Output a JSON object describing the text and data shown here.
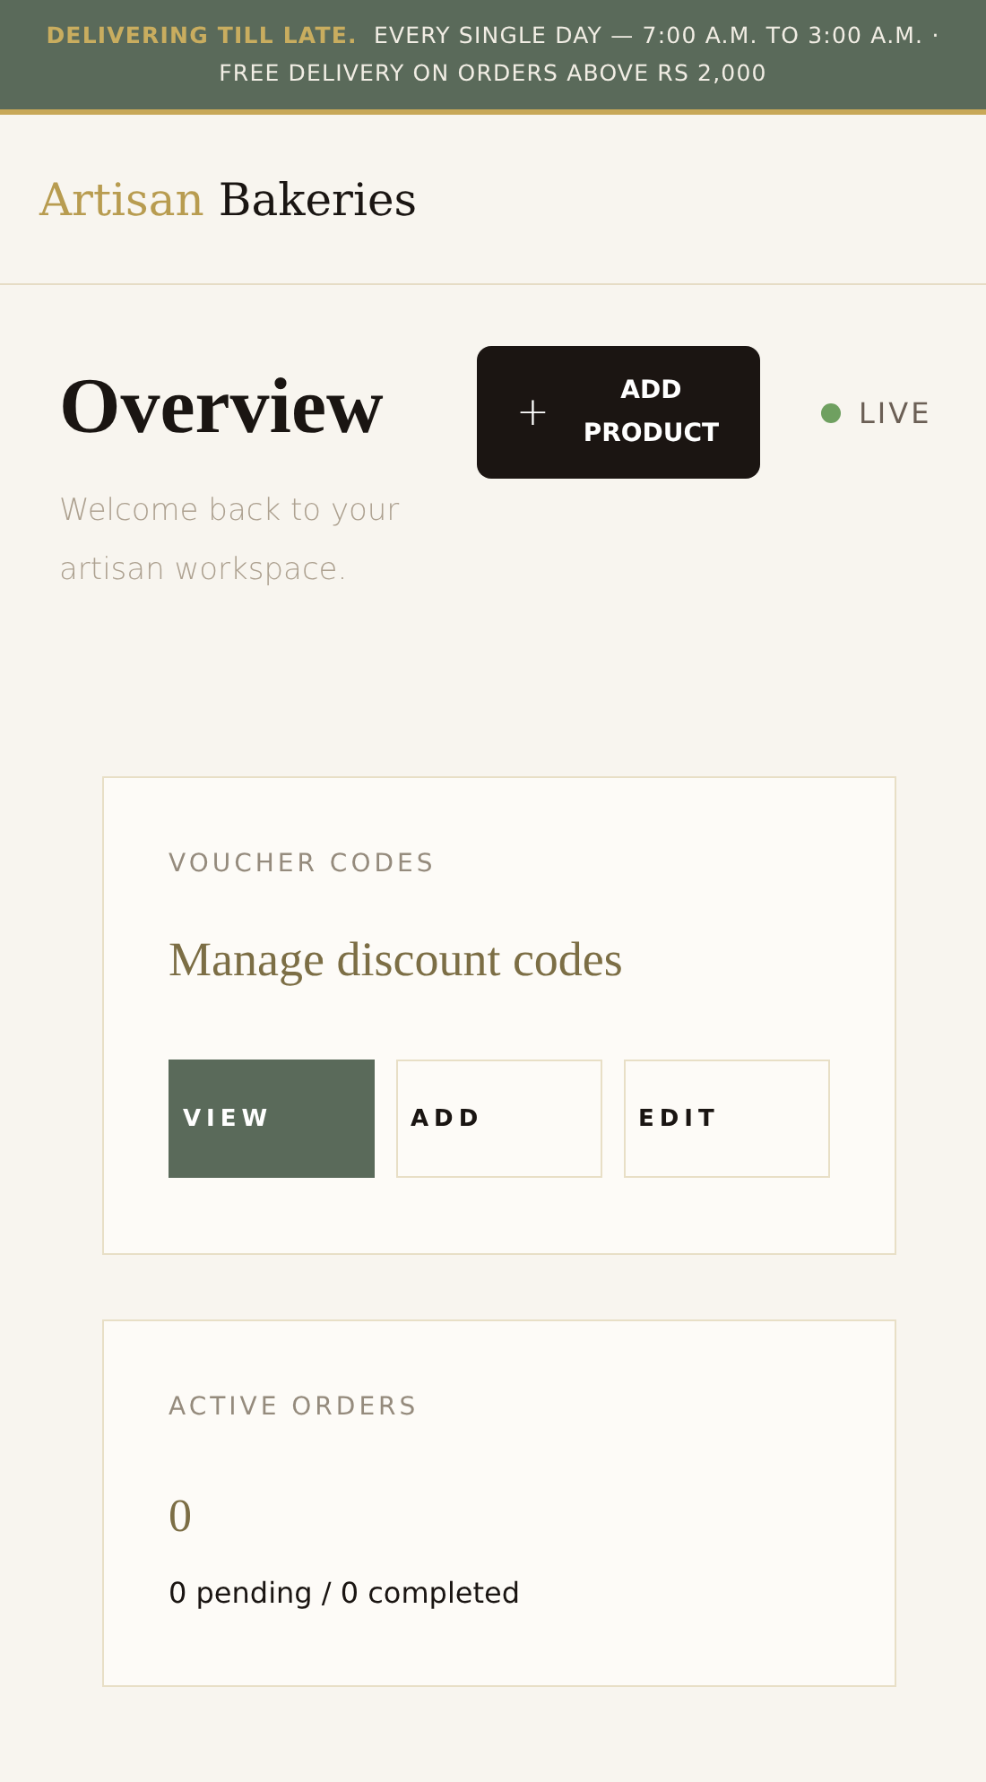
{
  "banner": {
    "highlight": "DELIVERING TILL LATE.",
    "text": "EVERY SINGLE DAY — 7:00 A.M. TO 3:00 A.M.  ·  FREE DELIVERY ON ORDERS ABOVE RS 2,000"
  },
  "brand": {
    "accent": "Artisan",
    "rest": "Bakeries"
  },
  "page": {
    "title": "Overview",
    "subtitle": "Welcome back to your artisan workspace.",
    "action": {
      "icon": "+",
      "label": "ADD PRODUCT"
    },
    "status": {
      "label": "LIVE",
      "color": "#6fa060"
    }
  },
  "cards": [
    {
      "kind": "actions",
      "eyebrow": "VOUCHER CODES",
      "heading": "Manage discount codes",
      "buttons": [
        {
          "label": "VIEW",
          "selected": true
        },
        {
          "label": "ADD",
          "selected": false
        },
        {
          "label": "EDIT",
          "selected": false
        }
      ]
    },
    {
      "kind": "stat",
      "eyebrow": "ACTIVE ORDERS",
      "value": "0",
      "detail": "0 pending / 0 completed"
    }
  ]
}
